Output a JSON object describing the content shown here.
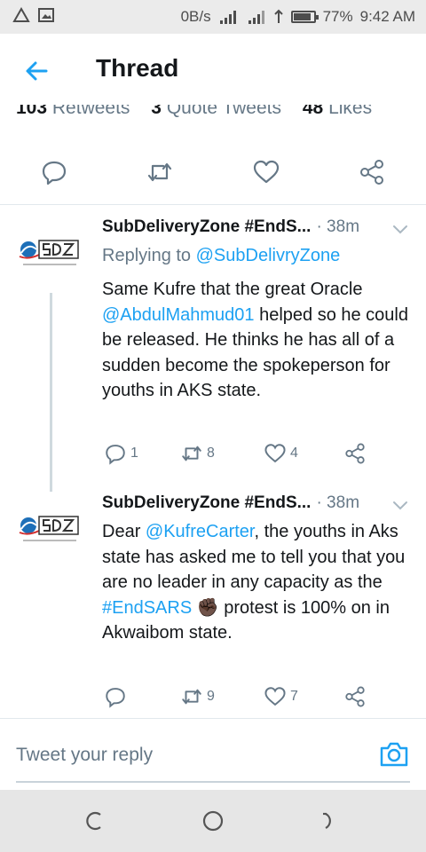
{
  "status_bar": {
    "network_speed": "0B/s",
    "battery_percent": "77%",
    "time": "9:42 AM"
  },
  "app_bar": {
    "title": "Thread"
  },
  "stats": {
    "retweets_count": "103",
    "retweets_label": "Retweets",
    "quotes_count": "3",
    "quotes_label": "Quote Tweets",
    "likes_count": "48",
    "likes_label": "Likes"
  },
  "tweets": [
    {
      "author": "SubDeliveryZone #EndS...",
      "time": "· 38m",
      "replying_prefix": "Replying to ",
      "replying_handle": "@SubDelivryZone",
      "body": {
        "p1": "Same Kufre that the great Oracle ",
        "mention": "@AbdulMahmud01",
        "p2": " helped so he could be released. He thinks he has all of a sudden become the spokeperson for youths in AKS state."
      },
      "replies": "1",
      "retweets": "8",
      "likes": "4"
    },
    {
      "author": "SubDeliveryZone #EndS...",
      "time": "· 38m",
      "body": {
        "p1": "Dear ",
        "mention": "@KufreCarter",
        "p2": ", the youths in Aks state has asked me to tell you that you are no leader in any capacity as the ",
        "hashtag": "#EndSARS",
        "emoji": "✊🏿",
        "p3": " protest is 100% on in Akwaibom state."
      },
      "replies": "",
      "retweets": "9",
      "likes": "7"
    }
  ],
  "reply_bar": {
    "placeholder": "Tweet your reply"
  },
  "colors": {
    "accent": "#1da1f2",
    "secondary_text": "#657786",
    "primary_text": "#14171a",
    "divider": "#e1e8ed"
  },
  "icons": [
    "signal-icon",
    "gallery-icon",
    "wifi-icon",
    "battery-icon",
    "back-arrow-icon",
    "reply-icon",
    "retweet-icon",
    "like-icon",
    "share-icon",
    "chevron-down-icon",
    "camera-icon",
    "nav-recent-icon",
    "nav-home-icon",
    "nav-back-icon"
  ]
}
